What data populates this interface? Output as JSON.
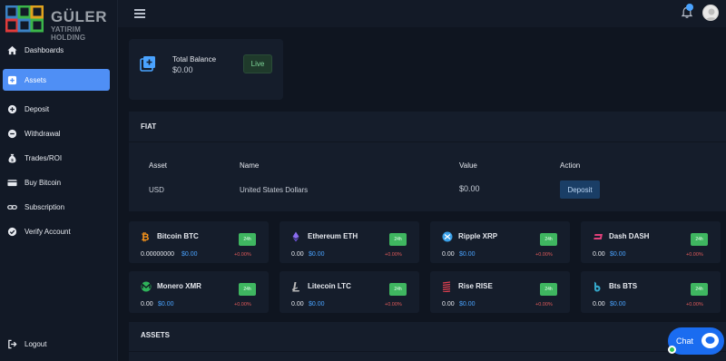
{
  "brand": {
    "name": "GÜLER",
    "subtitle": "YATIRIM HOLDING"
  },
  "sidebar": {
    "items": [
      {
        "label": "Dashboards",
        "icon": "home-icon",
        "active": false
      },
      {
        "label": "Assets",
        "icon": "plus-square-icon",
        "active": true
      },
      {
        "label": "Deposit",
        "icon": "plus-circle-icon",
        "active": false
      },
      {
        "label": "Withdrawal",
        "icon": "minus-circle-icon",
        "active": false
      },
      {
        "label": "Trades/ROI",
        "icon": "money-bag-icon",
        "active": false
      },
      {
        "label": "Buy Bitcoin",
        "icon": "credit-card-icon",
        "active": false
      },
      {
        "label": "Subscription",
        "icon": "link-icon",
        "active": false
      },
      {
        "label": "Verify Account",
        "icon": "check-circle-icon",
        "active": false
      }
    ],
    "logout": {
      "label": "Logout",
      "icon": "logout-icon"
    }
  },
  "topbar": {
    "menu_icon": "hamburger-icon",
    "notification_icon": "bell-icon",
    "avatar": "user-avatar"
  },
  "balance": {
    "label": "Total Balance",
    "value": "$0.00",
    "status": "Live"
  },
  "fiat": {
    "title": "FIAT",
    "columns": [
      "Asset",
      "Name",
      "Value",
      "Action"
    ],
    "rows": [
      {
        "asset": "USD",
        "name": "United States Dollars",
        "value": "$0.00",
        "action": "Deposit"
      }
    ]
  },
  "coins": [
    {
      "name": "Bitcoin BTC",
      "icon": "bitcoin-icon",
      "badge": "24h",
      "amount": "0.00000000",
      "usd": "$0.00",
      "change": "+0.00%"
    },
    {
      "name": "Ethereum ETH",
      "icon": "ethereum-icon",
      "badge": "24h",
      "amount": "0.00",
      "usd": "$0.00",
      "change": "+0.00%"
    },
    {
      "name": "Ripple XRP",
      "icon": "ripple-icon",
      "badge": "24h",
      "amount": "0.00",
      "usd": "$0.00",
      "change": "+0.00%"
    },
    {
      "name": "Dash DASH",
      "icon": "dash-icon",
      "badge": "24h",
      "amount": "0.00",
      "usd": "$0.00",
      "change": "+0.00%"
    },
    {
      "name": "Monero XMR",
      "icon": "monero-icon",
      "badge": "24h",
      "amount": "0.00",
      "usd": "$0.00",
      "change": "+0.00%"
    },
    {
      "name": "Litecoin LTC",
      "icon": "litecoin-icon",
      "badge": "24h",
      "amount": "0.00",
      "usd": "$0.00",
      "change": "+0.00%"
    },
    {
      "name": "Rise RISE",
      "icon": "rise-icon",
      "badge": "24h",
      "amount": "0.00",
      "usd": "$0.00",
      "change": "+0.00%"
    },
    {
      "name": "Bts BTS",
      "icon": "bitshares-icon",
      "badge": "24h",
      "amount": "0.00",
      "usd": "$0.00",
      "change": "+0.00%"
    }
  ],
  "assets_section": {
    "title": "ASSETS"
  },
  "chat": {
    "label": "Chat",
    "icon": "chat-bubble-icon"
  },
  "colors": {
    "accent": "#4f8ff5",
    "positive_badge": "#3fb660",
    "link_blue": "#4aa3ff",
    "negative_change": "#e05a5a",
    "background": "#0f1520",
    "card": "#151d2b"
  }
}
